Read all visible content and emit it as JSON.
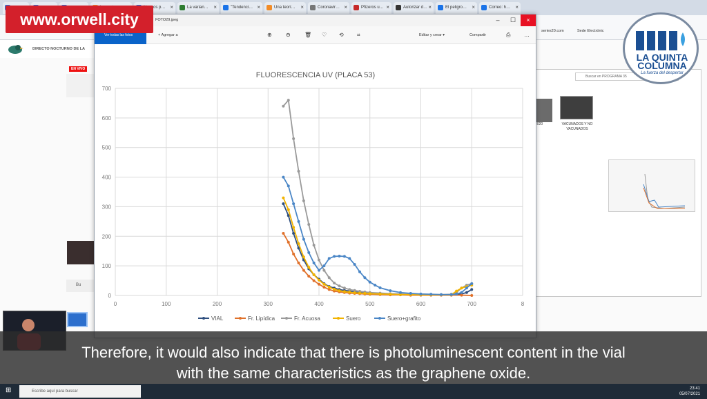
{
  "browser": {
    "tabs": [
      {
        "label": "",
        "color": "#1a73e8"
      },
      {
        "label": "",
        "color": "#1a73e8"
      },
      {
        "label": "",
        "color": "#1a73e8"
      },
      {
        "label": "Lo contar…",
        "color": "#f28c28"
      },
      {
        "label": "Nuevos p…",
        "color": "#1a73e8"
      },
      {
        "label": "La varian…",
        "color": "#2e7d32"
      },
      {
        "label": "\"Tendenci…",
        "color": "#1a73e8"
      },
      {
        "label": "Una teorí…",
        "color": "#f28c28"
      },
      {
        "label": "Coronavir…",
        "color": "#777777"
      },
      {
        "label": "Pfizeros u…",
        "color": "#c62828"
      },
      {
        "label": "Autorizar d…",
        "color": "#333333"
      },
      {
        "label": "El peligro…",
        "color": "#1a73e8"
      },
      {
        "label": "Correo: h…",
        "color": "#1a73e8"
      }
    ],
    "bookmarks": [
      "series20.com",
      "Sede Electrónic"
    ]
  },
  "left_app": {
    "title": "DIRECTO NOCTURNO DE LA",
    "live_badge": "EN VIVO",
    "search": "Bu"
  },
  "viewer": {
    "file_name": "FOTO29.jpeg",
    "see_all": "Ver todas las fotos",
    "add_to": "Agregar a",
    "edit_create": "Editar y crear",
    "share": "Compartir"
  },
  "explorer": {
    "search_placeholder": "Buscar en PROGRAMA 35",
    "folder1_label": "2020",
    "folder2_label": "VACUNADOS Y NO VACUNADOS"
  },
  "watermark": {
    "url": "www.orwell.city",
    "logo_line1": "LA QUINTA",
    "logo_line2": "COLUMNA",
    "logo_tagline": "La fuerza del despertar"
  },
  "subtitles": {
    "line1": "Therefore, it would also indicate that there is photoluminescent content in the vial",
    "line2": "with the same characteristics as the graphene oxide."
  },
  "taskbar": {
    "search_placeholder": "Escribe aquí para buscar",
    "time": "23:41",
    "date": "05/07/2021"
  },
  "chart_data": {
    "type": "line",
    "title": "FLUORESCENCIA UV   (PLACA 53)",
    "xlim": [
      0,
      800
    ],
    "ylim": [
      0,
      700
    ],
    "x_ticks": [
      "0",
      "100",
      "200",
      "300",
      "400",
      "500",
      "600",
      "700",
      "8"
    ],
    "y_ticks": [
      "0",
      "100",
      "200",
      "300",
      "400",
      "500",
      "600",
      "700"
    ],
    "grid": true,
    "legend_position": "bottom",
    "series": [
      {
        "name": "VIAL",
        "color": "#2f4f7f",
        "points": [
          [
            330,
            310
          ],
          [
            340,
            270
          ],
          [
            350,
            210
          ],
          [
            360,
            160
          ],
          [
            370,
            120
          ],
          [
            380,
            90
          ],
          [
            390,
            70
          ],
          [
            400,
            55
          ],
          [
            410,
            40
          ],
          [
            420,
            30
          ],
          [
            430,
            25
          ],
          [
            440,
            20
          ],
          [
            450,
            17
          ],
          [
            460,
            15
          ],
          [
            470,
            12
          ],
          [
            480,
            10
          ],
          [
            490,
            8
          ],
          [
            500,
            6
          ],
          [
            520,
            5
          ],
          [
            540,
            4
          ],
          [
            560,
            3
          ],
          [
            580,
            3
          ],
          [
            600,
            2
          ],
          [
            620,
            2
          ],
          [
            640,
            2
          ],
          [
            660,
            3
          ],
          [
            670,
            4
          ],
          [
            680,
            5
          ],
          [
            690,
            10
          ],
          [
            700,
            20
          ]
        ]
      },
      {
        "name": "Fr. Lipídica",
        "color": "#e0712b",
        "points": [
          [
            330,
            210
          ],
          [
            340,
            180
          ],
          [
            350,
            140
          ],
          [
            360,
            110
          ],
          [
            370,
            85
          ],
          [
            380,
            65
          ],
          [
            390,
            50
          ],
          [
            400,
            38
          ],
          [
            410,
            28
          ],
          [
            420,
            20
          ],
          [
            430,
            15
          ],
          [
            440,
            12
          ],
          [
            450,
            10
          ],
          [
            460,
            8
          ],
          [
            470,
            7
          ],
          [
            480,
            6
          ],
          [
            490,
            5
          ],
          [
            500,
            4
          ],
          [
            520,
            3
          ],
          [
            540,
            2
          ],
          [
            560,
            2
          ],
          [
            580,
            1
          ],
          [
            600,
            1
          ],
          [
            620,
            1
          ],
          [
            640,
            1
          ],
          [
            660,
            1
          ],
          [
            680,
            1
          ],
          [
            700,
            0
          ]
        ]
      },
      {
        "name": "Fr. Acuosa",
        "color": "#9a9a9a",
        "points": [
          [
            330,
            640
          ],
          [
            340,
            660
          ],
          [
            350,
            530
          ],
          [
            360,
            420
          ],
          [
            370,
            320
          ],
          [
            380,
            240
          ],
          [
            390,
            170
          ],
          [
            400,
            120
          ],
          [
            410,
            85
          ],
          [
            420,
            60
          ],
          [
            430,
            42
          ],
          [
            440,
            32
          ],
          [
            450,
            25
          ],
          [
            460,
            20
          ],
          [
            470,
            17
          ],
          [
            480,
            14
          ],
          [
            490,
            12
          ],
          [
            500,
            10
          ],
          [
            520,
            8
          ],
          [
            540,
            6
          ],
          [
            560,
            5
          ],
          [
            580,
            4
          ],
          [
            600,
            3
          ],
          [
            620,
            3
          ],
          [
            640,
            3
          ],
          [
            660,
            4
          ],
          [
            670,
            10
          ],
          [
            680,
            25
          ],
          [
            690,
            35
          ],
          [
            700,
            40
          ]
        ]
      },
      {
        "name": "Suero",
        "color": "#f2b300",
        "points": [
          [
            330,
            330
          ],
          [
            340,
            290
          ],
          [
            350,
            230
          ],
          [
            360,
            175
          ],
          [
            370,
            130
          ],
          [
            380,
            95
          ],
          [
            390,
            70
          ],
          [
            400,
            52
          ],
          [
            410,
            38
          ],
          [
            420,
            28
          ],
          [
            430,
            21
          ],
          [
            440,
            16
          ],
          [
            450,
            13
          ],
          [
            460,
            11
          ],
          [
            470,
            9
          ],
          [
            480,
            8
          ],
          [
            490,
            7
          ],
          [
            500,
            6
          ],
          [
            520,
            5
          ],
          [
            540,
            4
          ],
          [
            560,
            3
          ],
          [
            580,
            3
          ],
          [
            600,
            2
          ],
          [
            620,
            2
          ],
          [
            640,
            2
          ],
          [
            660,
            2
          ],
          [
            670,
            15
          ],
          [
            680,
            25
          ],
          [
            690,
            30
          ],
          [
            700,
            35
          ]
        ]
      },
      {
        "name": "Suero+grafito",
        "color": "#4a86c6",
        "points": [
          [
            330,
            400
          ],
          [
            340,
            370
          ],
          [
            350,
            310
          ],
          [
            360,
            250
          ],
          [
            370,
            190
          ],
          [
            380,
            145
          ],
          [
            390,
            110
          ],
          [
            400,
            85
          ],
          [
            410,
            100
          ],
          [
            420,
            125
          ],
          [
            430,
            132
          ],
          [
            440,
            133
          ],
          [
            450,
            132
          ],
          [
            460,
            125
          ],
          [
            470,
            105
          ],
          [
            480,
            80
          ],
          [
            490,
            60
          ],
          [
            500,
            45
          ],
          [
            510,
            35
          ],
          [
            520,
            26
          ],
          [
            540,
            16
          ],
          [
            560,
            10
          ],
          [
            580,
            7
          ],
          [
            600,
            5
          ],
          [
            620,
            4
          ],
          [
            640,
            3
          ],
          [
            660,
            3
          ],
          [
            670,
            5
          ],
          [
            680,
            10
          ],
          [
            690,
            25
          ],
          [
            700,
            40
          ]
        ]
      }
    ]
  }
}
